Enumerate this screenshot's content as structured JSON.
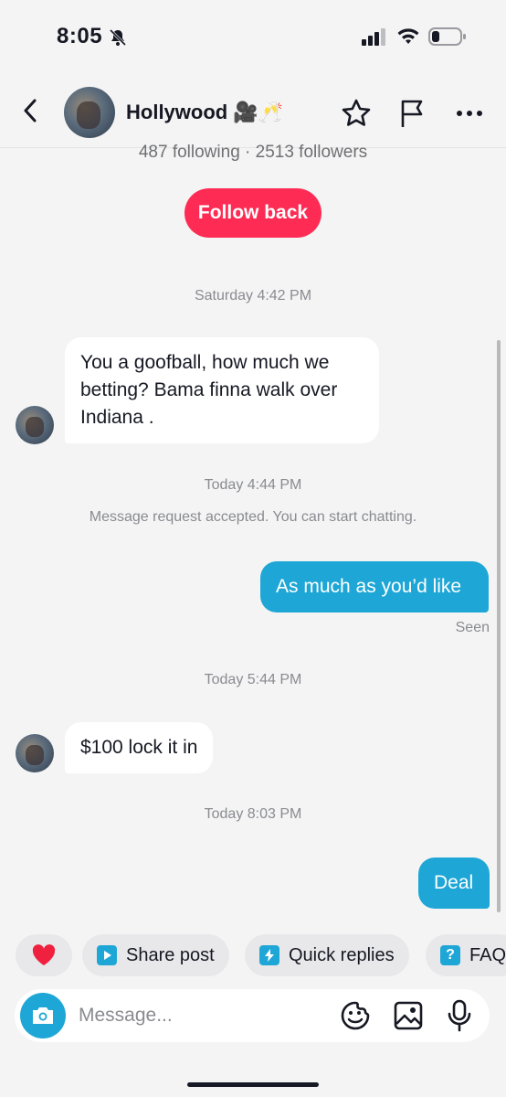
{
  "status_bar": {
    "time": "8:05",
    "icons": [
      "bell-slash-icon",
      "signal-icon",
      "wifi-icon",
      "battery-icon"
    ]
  },
  "header": {
    "contact_name": "Hollywood",
    "name_emojis": "🎥🥂",
    "actions": [
      "back-icon",
      "star-icon",
      "flag-icon",
      "more-icon"
    ]
  },
  "profile": {
    "stats": "487 following · 2513 followers",
    "follow_back_label": "Follow back"
  },
  "messages": [
    {
      "type": "timestamp",
      "text": "Saturday 4:42 PM"
    },
    {
      "type": "incoming",
      "text": "You a goofball, how much we betting? Bama finna walk over Indiana ."
    },
    {
      "type": "timestamp",
      "text": "Today 4:44 PM"
    },
    {
      "type": "system",
      "text": "Message request accepted. You can start chatting."
    },
    {
      "type": "outgoing",
      "text": "As much as you’d like"
    },
    {
      "type": "status",
      "text": "Seen"
    },
    {
      "type": "timestamp",
      "text": "Today 5:44 PM"
    },
    {
      "type": "incoming",
      "text": "$100 lock it in"
    },
    {
      "type": "timestamp",
      "text": "Today 8:03 PM"
    },
    {
      "type": "outgoing",
      "text": "Deal"
    }
  ],
  "quick_actions": [
    {
      "icon": "heart-icon",
      "label": ""
    },
    {
      "icon": "share-post-icon",
      "label": "Share post"
    },
    {
      "icon": "quick-replies-icon",
      "label": "Quick replies"
    },
    {
      "icon": "faq-icon",
      "label": "FAQ"
    }
  ],
  "composer": {
    "placeholder": "Message..."
  },
  "colors": {
    "accent_red": "#fe2c55",
    "outgoing_bubble": "#1ea7d6",
    "background": "#f4f4f4"
  }
}
